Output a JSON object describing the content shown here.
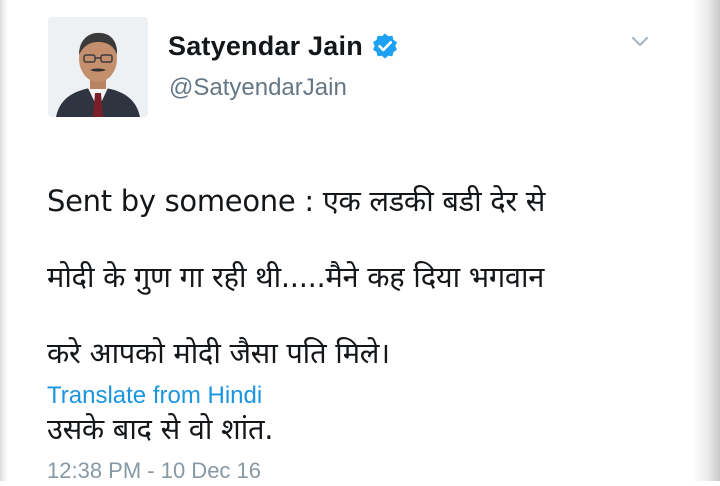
{
  "tweet": {
    "author": {
      "display_name": "Satyendar Jain",
      "handle": "@SatyendarJain",
      "verified": true,
      "avatar_icon": "profile-photo"
    },
    "text_lines": [
      "Sent by someone : एक लडकी बडी देर से",
      "मोदी के गुण गा रही थी.....मैने कह दिया भगवान",
      "करे आपको मोदी जैसा पति मिले।",
      "उसके बाद से वो शांत."
    ],
    "translate_label": "Translate from Hindi",
    "timestamp": "12:38 PM - 10 Dec 16",
    "menu_icon": "chevron-down-icon"
  },
  "colors": {
    "verified_badge": "#1da1f2",
    "link": "#1b95e0",
    "secondary_text": "#657786"
  }
}
